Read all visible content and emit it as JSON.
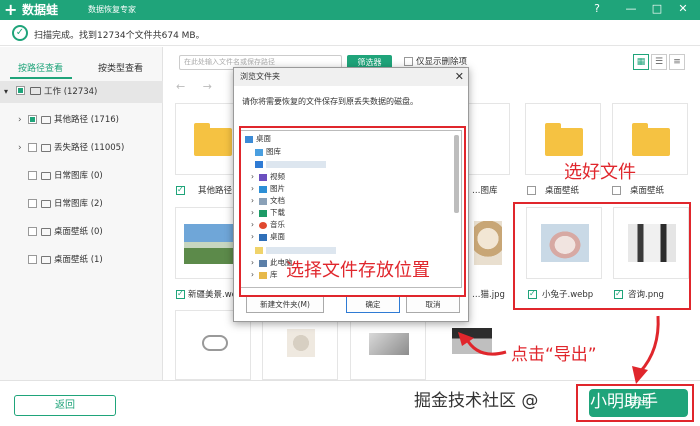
{
  "titlebar": {
    "logo_glyph": "+",
    "app_name": "数据蛙",
    "subtitle": "数据恢复专家",
    "buttons": [
      "?",
      "—",
      "□",
      "✕"
    ]
  },
  "status": {
    "text": "扫描完成。找到12734个文件共674 MB。"
  },
  "sidebar": {
    "tabs": [
      "按路径查看",
      "按类型查看"
    ],
    "root": {
      "label": "工作 (12734)"
    },
    "items": [
      {
        "label": "其他路径 (1716)",
        "expandable": true,
        "state": "partial"
      },
      {
        "label": "丢失路径 (11005)",
        "expandable": true,
        "state": "empty"
      },
      {
        "label": "日常图库 (0)",
        "expandable": false,
        "state": "empty"
      },
      {
        "label": "日常图库 (2)",
        "expandable": false,
        "state": "empty"
      },
      {
        "label": "桌面壁纸 (0)",
        "expandable": false,
        "state": "empty"
      },
      {
        "label": "桌面壁纸 (1)",
        "expandable": false,
        "state": "empty"
      }
    ]
  },
  "toolbar": {
    "search_placeholder": "在此处输入文件名或保存路径",
    "filter_label": "筛选器",
    "only_deleted_label": "仅显示删除项",
    "view_icons": [
      "▦",
      "☰",
      "≡"
    ]
  },
  "grid": {
    "row1_labels": [
      "其他路径",
      "…图库",
      "桌面壁纸",
      "桌面壁纸"
    ],
    "row2_labels": [
      "新疆美景.we…",
      "…猫.jpg",
      "小兔子.webp",
      "咨询.png"
    ]
  },
  "bottom": {
    "back_label": "返回",
    "export_label": "导出"
  },
  "dialog": {
    "title": "浏览文件夹",
    "close": "✕",
    "message": "请你将需要恢复的文件保存到原丢失数据的磁盘。",
    "tree": [
      {
        "label": "桌面",
        "indent": 0,
        "arrow": ""
      },
      {
        "label": "图库",
        "indent": 1,
        "arrow": ""
      },
      {
        "label": "",
        "indent": 1,
        "arrow": ""
      },
      {
        "label": "视频",
        "indent": 1,
        "arrow": ">"
      },
      {
        "label": "图片",
        "indent": 1,
        "arrow": ">"
      },
      {
        "label": "文档",
        "indent": 1,
        "arrow": ">"
      },
      {
        "label": "下载",
        "indent": 1,
        "arrow": ">"
      },
      {
        "label": "音乐",
        "indent": 1,
        "arrow": ">"
      },
      {
        "label": "桌面",
        "indent": 1,
        "arrow": ">"
      },
      {
        "label": "",
        "indent": 1,
        "arrow": ""
      },
      {
        "label": "此电脑",
        "indent": 1,
        "arrow": ">"
      },
      {
        "label": "库",
        "indent": 1,
        "arrow": ">"
      }
    ],
    "new_folder_label": "新建文件夹(M)",
    "ok_label": "确定",
    "cancel_label": "取消"
  },
  "annotations": {
    "select_files": "选好文件",
    "choose_location": "选择文件存放位置",
    "click_export": "点击“导出”"
  },
  "watermark": {
    "text": "掘金技术社区 @",
    "author": "小明助手"
  },
  "colors": {
    "brand": "#1fa47a",
    "annotation": "#e0262c"
  }
}
